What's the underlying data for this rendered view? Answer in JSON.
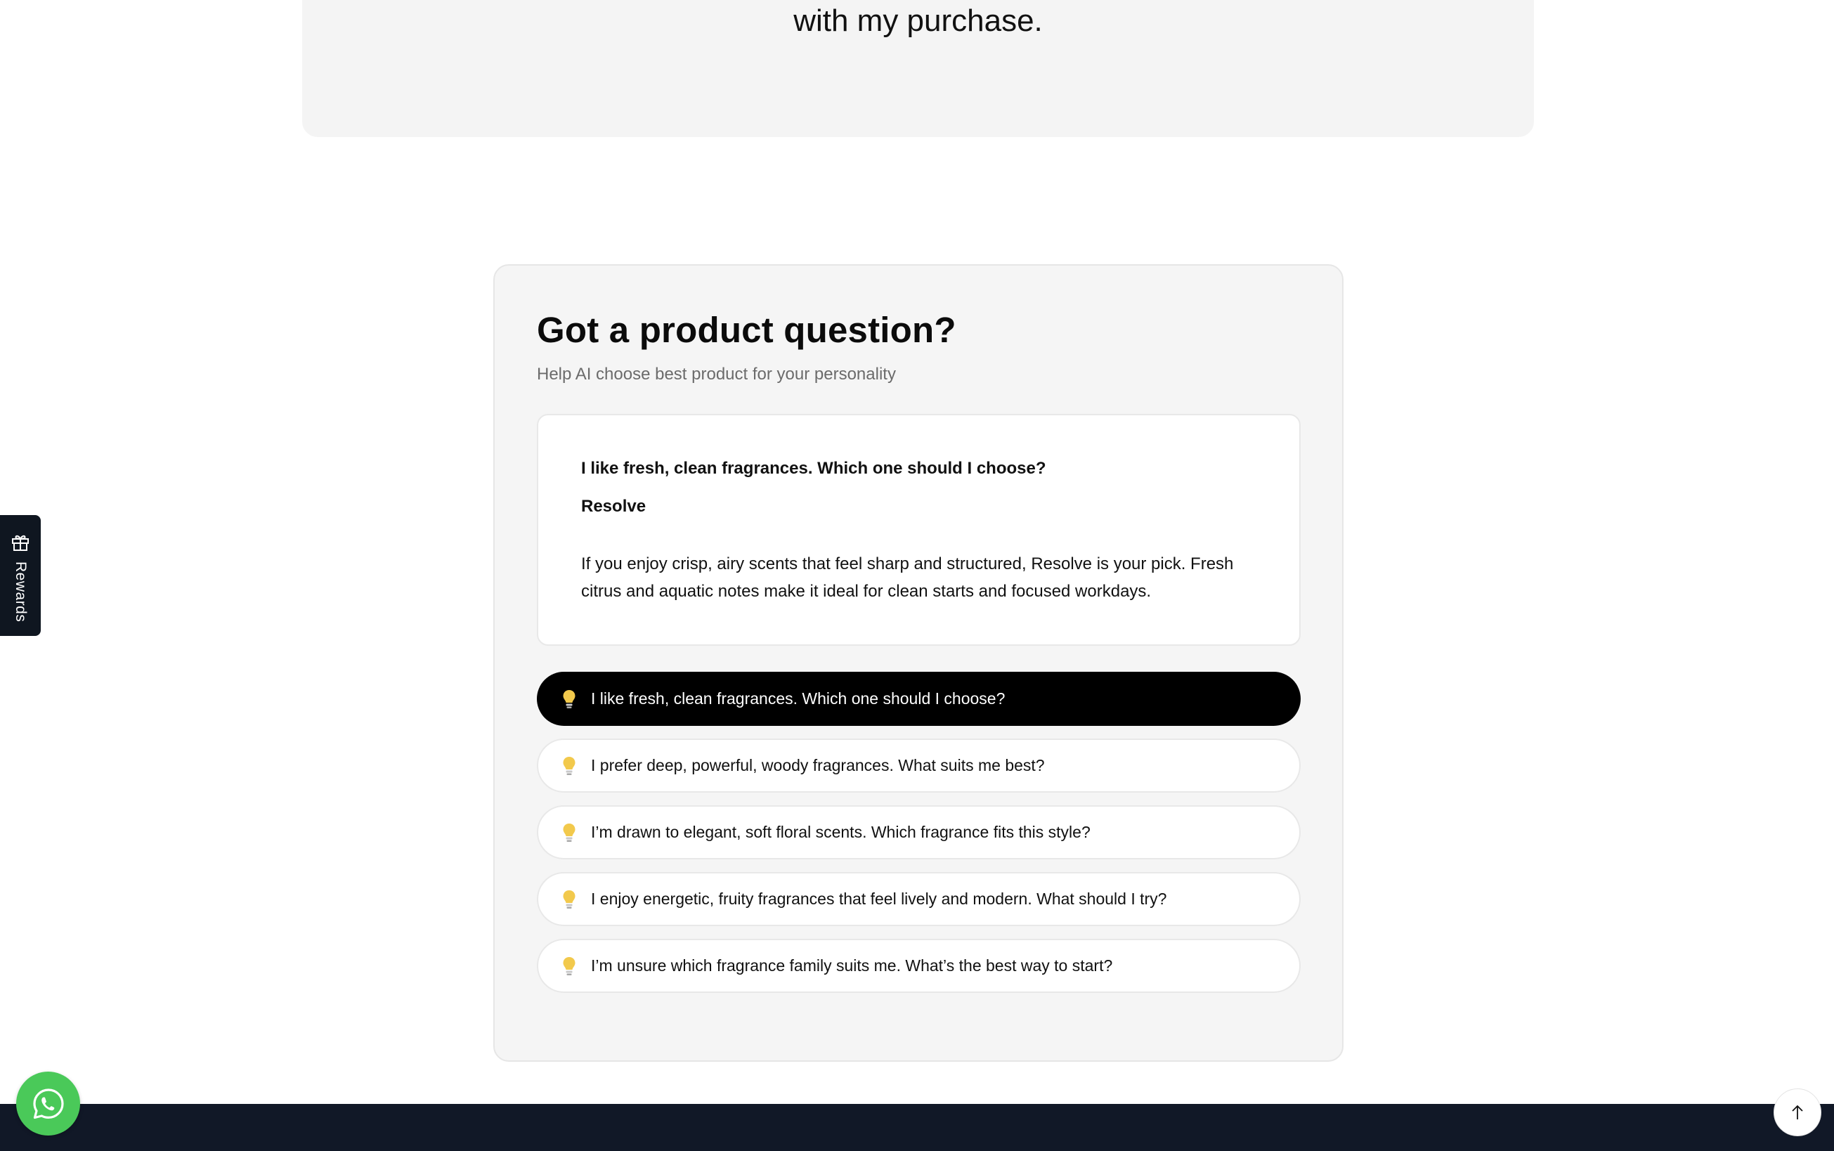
{
  "testimonial": {
    "text_fragment": "with my purchase."
  },
  "qa": {
    "title": "Got a product question?",
    "subtitle": "Help AI choose best product for your personality",
    "answer": {
      "question": "I like fresh, clean fragrances. Which one should I choose?",
      "product": "Resolve",
      "body": "If you enjoy crisp, airy scents that feel sharp and structured, Resolve is your pick. Fresh citrus and aquatic notes make it ideal for clean starts and focused workdays."
    },
    "suggestions": [
      {
        "label": "I like fresh, clean fragrances. Which one should I choose?",
        "active": true
      },
      {
        "label": "I prefer deep, powerful, woody fragrances. What suits me best?",
        "active": false
      },
      {
        "label": "I’m drawn to elegant, soft floral scents. Which fragrance fits this style?",
        "active": false
      },
      {
        "label": "I enjoy energetic, fruity fragrances that feel lively and modern. What should I try?",
        "active": false
      },
      {
        "label": "I’m unsure which fragrance family suits me. What’s the best way to start?",
        "active": false
      }
    ],
    "suggestion_icon": "lightbulb-icon"
  },
  "rewards": {
    "label": "Rewards",
    "icon": "gift-icon"
  },
  "widgets": {
    "whatsapp_icon": "whatsapp-icon",
    "scroll_top_icon": "arrow-up-icon"
  },
  "colors": {
    "active_pill": "#000000",
    "section_bg": "#f5f5f5",
    "footer_bg": "#111827",
    "whatsapp_green": "#4ac959",
    "bulb_yellow": "#f2c94c"
  }
}
